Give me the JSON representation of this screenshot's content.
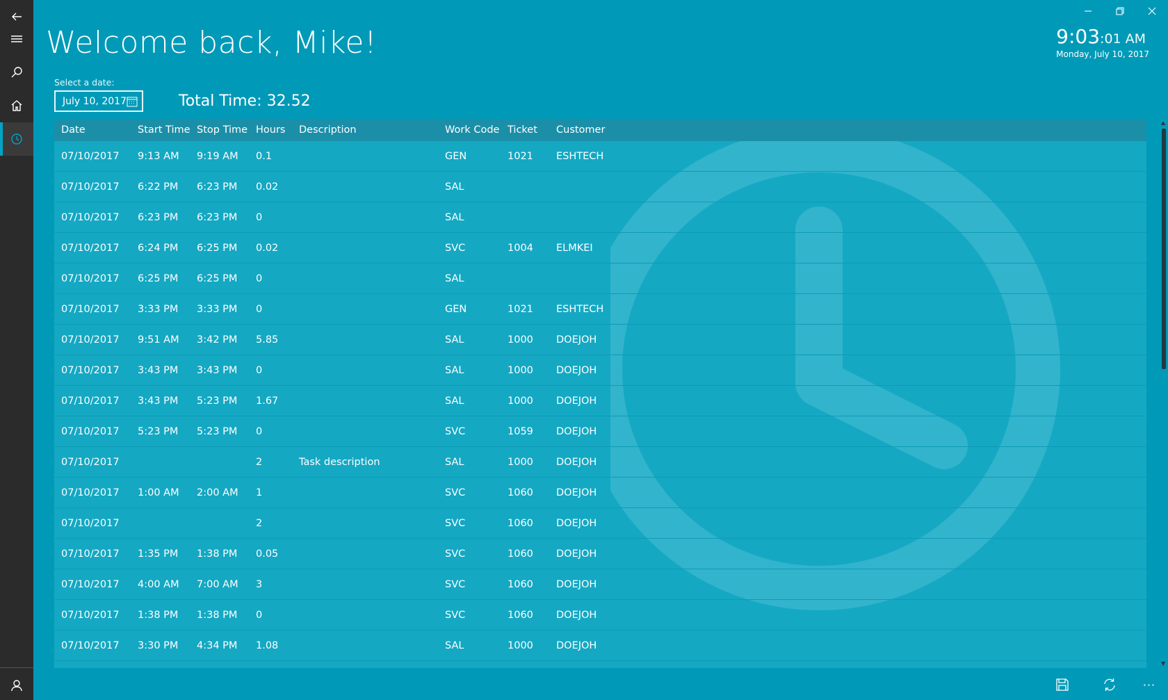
{
  "sidebar": {
    "items": [
      "back",
      "menu",
      "search",
      "home",
      "history"
    ],
    "active": "history",
    "bottom": "account"
  },
  "window_controls": [
    "minimize",
    "restore",
    "close"
  ],
  "header": {
    "welcome": "Welcome back, Mike!",
    "clock_hm": "9:03",
    "clock_sec": ":01 AM",
    "clock_date": "Monday, July 10, 2017"
  },
  "filters": {
    "select_label": "Select a date:",
    "date_value": "July 10, 2017",
    "total_time": "Total Time: 32.52"
  },
  "table": {
    "columns": [
      "Date",
      "Start Time",
      "Stop Time",
      "Hours",
      "Description",
      "Work Code",
      "Ticket",
      "Customer"
    ],
    "rows": [
      [
        "07/10/2017",
        "9:13 AM",
        "9:19 AM",
        "0.1",
        "",
        "GEN",
        "1021",
        "ESHTECH"
      ],
      [
        "07/10/2017",
        "6:22 PM",
        "6:23 PM",
        "0.02",
        "",
        "SAL",
        "",
        ""
      ],
      [
        "07/10/2017",
        "6:23 PM",
        "6:23 PM",
        "0",
        "",
        "SAL",
        "",
        ""
      ],
      [
        "07/10/2017",
        "6:24 PM",
        "6:25 PM",
        "0.02",
        "",
        "SVC",
        "1004",
        "ELMKEI"
      ],
      [
        "07/10/2017",
        "6:25 PM",
        "6:25 PM",
        "0",
        "",
        "SAL",
        "",
        ""
      ],
      [
        "07/10/2017",
        "3:33 PM",
        "3:33 PM",
        "0",
        "",
        "GEN",
        "1021",
        "ESHTECH"
      ],
      [
        "07/10/2017",
        "9:51 AM",
        "3:42 PM",
        "5.85",
        "",
        "SAL",
        "1000",
        "DOEJOH"
      ],
      [
        "07/10/2017",
        "3:43 PM",
        "3:43 PM",
        "0",
        "",
        "SAL",
        "1000",
        "DOEJOH"
      ],
      [
        "07/10/2017",
        "3:43 PM",
        "5:23 PM",
        "1.67",
        "",
        "SAL",
        "1000",
        "DOEJOH"
      ],
      [
        "07/10/2017",
        "5:23 PM",
        "5:23 PM",
        "0",
        "",
        "SVC",
        "1059",
        "DOEJOH"
      ],
      [
        "07/10/2017",
        "",
        "",
        "2",
        "Task description",
        "SAL",
        "1000",
        "DOEJOH"
      ],
      [
        "07/10/2017",
        "1:00 AM",
        "2:00 AM",
        "1",
        "",
        "SVC",
        "1060",
        "DOEJOH"
      ],
      [
        "07/10/2017",
        "",
        "",
        "2",
        "",
        "SVC",
        "1060",
        "DOEJOH"
      ],
      [
        "07/10/2017",
        "1:35 PM",
        "1:38 PM",
        "0.05",
        "",
        "SVC",
        "1060",
        "DOEJOH"
      ],
      [
        "07/10/2017",
        "4:00 AM",
        "7:00 AM",
        "3",
        "",
        "SVC",
        "1060",
        "DOEJOH"
      ],
      [
        "07/10/2017",
        "1:38 PM",
        "1:38 PM",
        "0",
        "",
        "SVC",
        "1060",
        "DOEJOH"
      ],
      [
        "07/10/2017",
        "3:30 PM",
        "4:34 PM",
        "1.08",
        "",
        "SAL",
        "1000",
        "DOEJOH"
      ]
    ]
  },
  "command_bar": {
    "buttons": [
      "save",
      "sync",
      "more"
    ],
    "more_label": "···"
  },
  "colors": {
    "background": "#009ab8",
    "sidebar": "#2b2b2b",
    "header_row": "#1b8fa8",
    "rows": "#14a8c3"
  }
}
